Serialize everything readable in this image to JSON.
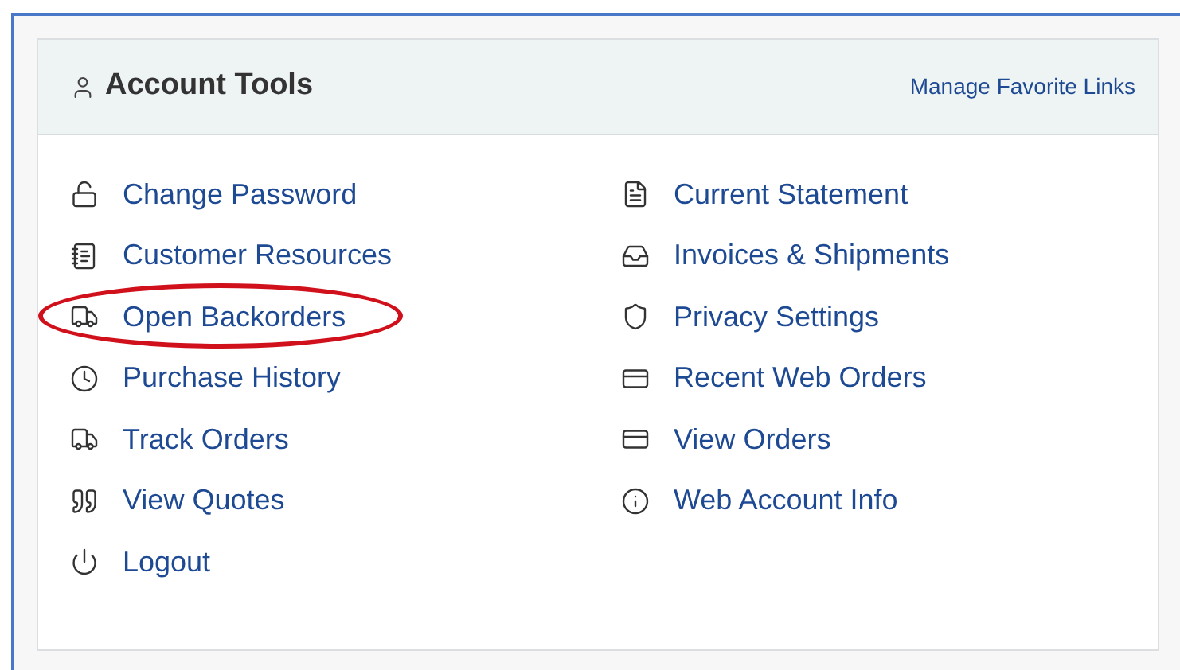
{
  "panel": {
    "title": "Account Tools",
    "header_link": "Manage Favorite Links"
  },
  "columns": [
    [
      {
        "label": "Change Password",
        "kind": "lock-open",
        "highlighted": false
      },
      {
        "label": "Customer Resources",
        "kind": "notebook",
        "highlighted": false
      },
      {
        "label": "Open Backorders",
        "kind": "truck",
        "highlighted": true
      },
      {
        "label": "Purchase History",
        "kind": "clock",
        "highlighted": false
      },
      {
        "label": "Track Orders",
        "kind": "truck",
        "highlighted": false
      },
      {
        "label": "View Quotes",
        "kind": "quote",
        "highlighted": false
      },
      {
        "label": "Logout",
        "kind": "power",
        "highlighted": false
      }
    ],
    [
      {
        "label": "Current Statement",
        "kind": "document",
        "highlighted": false
      },
      {
        "label": "Invoices & Shipments",
        "kind": "inbox",
        "highlighted": false
      },
      {
        "label": "Privacy Settings",
        "kind": "shield",
        "highlighted": false
      },
      {
        "label": "Recent Web Orders",
        "kind": "card",
        "highlighted": false
      },
      {
        "label": "View Orders",
        "kind": "card",
        "highlighted": false
      },
      {
        "label": "Web Account Info",
        "kind": "info",
        "highlighted": false
      }
    ]
  ]
}
